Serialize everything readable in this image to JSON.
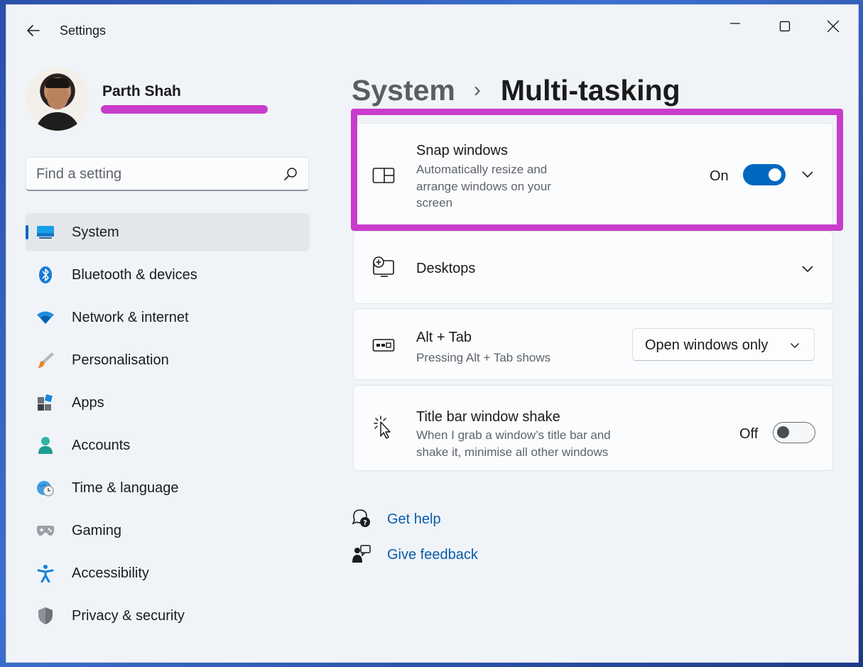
{
  "window": {
    "title": "Settings"
  },
  "user": {
    "name": "Parth Shah"
  },
  "search": {
    "placeholder": "Find a setting"
  },
  "sidebar": {
    "items": [
      {
        "label": "System",
        "icon": "system-icon",
        "selected": true
      },
      {
        "label": "Bluetooth & devices",
        "icon": "bluetooth-icon"
      },
      {
        "label": "Network & internet",
        "icon": "wifi-icon"
      },
      {
        "label": "Personalisation",
        "icon": "brush-icon"
      },
      {
        "label": "Apps",
        "icon": "apps-icon"
      },
      {
        "label": "Accounts",
        "icon": "accounts-icon"
      },
      {
        "label": "Time & language",
        "icon": "globe-clock-icon"
      },
      {
        "label": "Gaming",
        "icon": "gamepad-icon"
      },
      {
        "label": "Accessibility",
        "icon": "accessibility-icon"
      },
      {
        "label": "Privacy & security",
        "icon": "shield-icon"
      }
    ]
  },
  "breadcrumb": {
    "parent": "System",
    "separator": "›",
    "current": "Multi-tasking"
  },
  "settings": {
    "snap": {
      "title": "Snap windows",
      "description": "Automatically resize and arrange windows on your screen",
      "state_label": "On",
      "enabled": true
    },
    "desktops": {
      "title": "Desktops"
    },
    "alt_tab": {
      "title": "Alt + Tab",
      "description": "Pressing Alt + Tab shows",
      "selected": "Open windows only"
    },
    "shake": {
      "title": "Title bar window shake",
      "description": "When I grab a window’s title bar and shake it, minimise all other windows",
      "state_label": "Off",
      "enabled": false
    }
  },
  "links": {
    "help": "Get help",
    "feedback": "Give feedback"
  },
  "colors": {
    "accent": "#0067c0",
    "highlight_annotation": "#c93ccb",
    "link": "#0a5ca8"
  }
}
